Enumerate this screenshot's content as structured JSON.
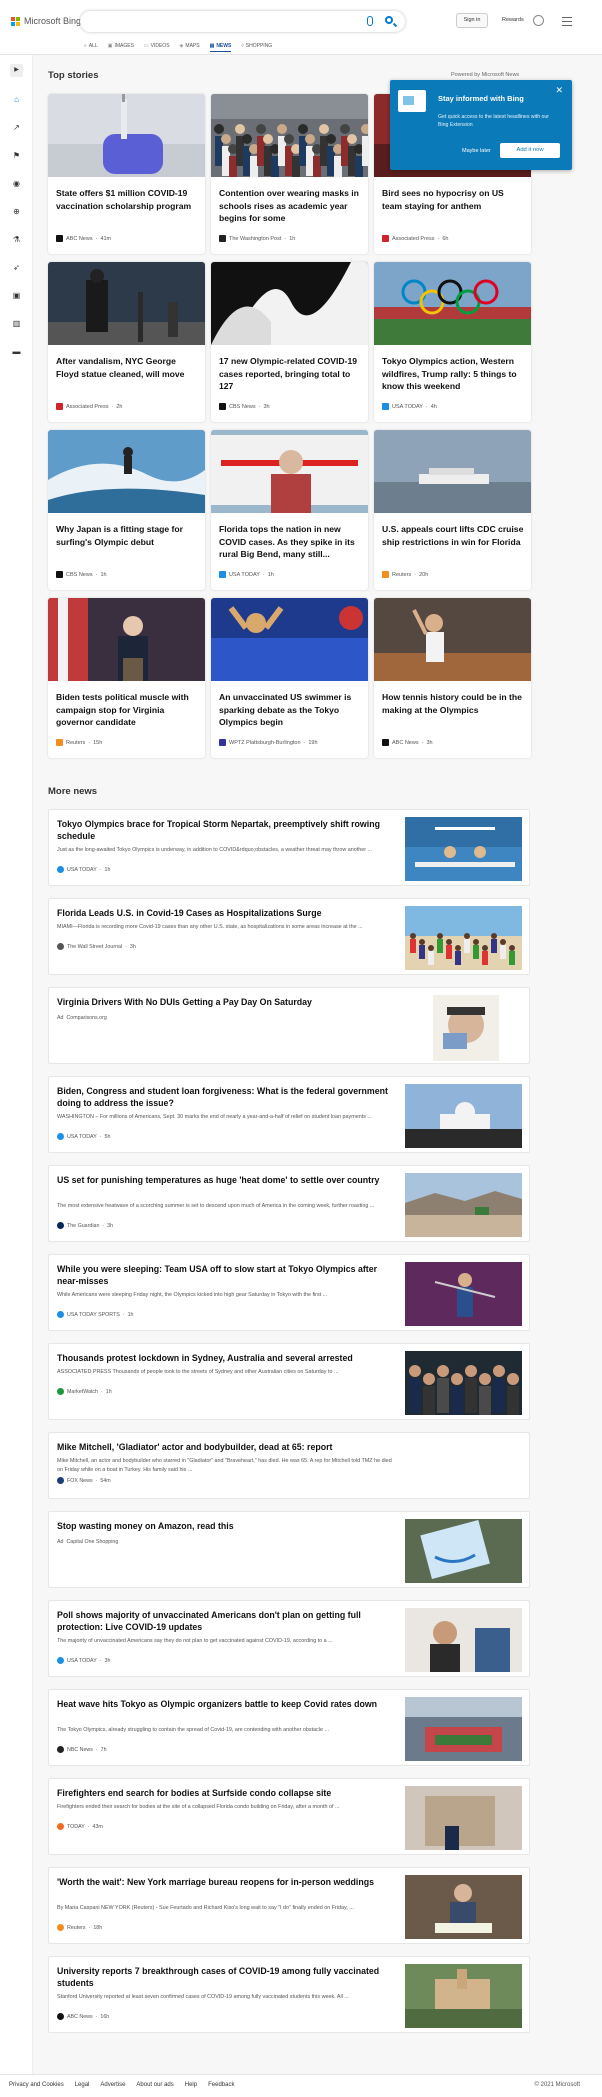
{
  "header": {
    "brand": "Microsoft Bing",
    "signin": "Sign in",
    "rewards": "Rewards",
    "tabs": [
      "ALL",
      "IMAGES",
      "VIDEOS",
      "MAPS",
      "NEWS",
      "SHOPPING"
    ],
    "active_tab": "NEWS"
  },
  "top_stories": {
    "title": "Top stories",
    "powered": "Powered by Microsoft News",
    "cards": [
      {
        "title": "State offers $1 million COVID-19 vaccination scholarship program",
        "source": "ABC News",
        "time": "41m",
        "logo_color": "#111111",
        "image": "vaccine"
      },
      {
        "title": "Contention over wearing masks in schools rises as academic year begins for some",
        "source": "The Washington Post",
        "time": "1h",
        "logo_color": "#222222",
        "image": "crowd"
      },
      {
        "title": "Bird sees no hypocrisy on US team staying for anthem",
        "source": "Associated Press",
        "time": "6h",
        "logo_color": "#d2232a",
        "image": "basketball"
      },
      {
        "title": "After vandalism, NYC George Floyd statue cleaned, will move",
        "source": "Associated Press",
        "time": "2h",
        "logo_color": "#d2232a",
        "image": "statue"
      },
      {
        "title": "17 new Olympic-related COVID-19 cases reported, bringing total to 127",
        "source": "CBS News",
        "time": "3h",
        "logo_color": "#111111",
        "image": "ceremony"
      },
      {
        "title": "Tokyo Olympics action, Western wildfires, Trump rally: 5 things to know this weekend",
        "source": "USA TODAY",
        "time": "4h",
        "logo_color": "#1a8fe3",
        "image": "rings"
      },
      {
        "title": "Why Japan is a fitting stage for surfing's Olympic debut",
        "source": "CBS News",
        "time": "1h",
        "logo_color": "#111111",
        "image": "surf"
      },
      {
        "title": "Florida tops the nation in new COVID cases. As they spike in its rural Big Bend, many still...",
        "source": "USA TODAY",
        "time": "1h",
        "logo_color": "#1a8fe3",
        "image": "ambulance"
      },
      {
        "title": "U.S. appeals court lifts CDC cruise ship restrictions in win for Florida",
        "source": "Reuters",
        "time": "20h",
        "logo_color": "#f48c1e",
        "image": "ship"
      },
      {
        "title": "Biden tests political muscle with campaign stop for Virginia governor candidate",
        "source": "Reuters",
        "time": "15h",
        "logo_color": "#f48c1e",
        "image": "biden"
      },
      {
        "title": "An unvaccinated US swimmer is sparking debate as the Tokyo Olympics begin",
        "source": "WPTZ Plattsburgh-Burlington",
        "time": "19h",
        "logo_color": "#333399",
        "image": "swimmer"
      },
      {
        "title": "How tennis history could be in the making at the Olympics",
        "source": "ABC News",
        "time": "3h",
        "logo_color": "#111111",
        "image": "tennis"
      }
    ]
  },
  "popup": {
    "title": "Stay informed with Bing",
    "body": "Get quick access to the latest headlines with our Bing Extension",
    "later": "Maybe later",
    "add": "Add it now"
  },
  "more_news": {
    "title": "More news",
    "items": [
      {
        "title": "Tokyo Olympics brace for Tropical Storm Nepartak, preemptively shift rowing schedule",
        "desc": "Just as the long-awaited Tokyo Olympics is underway, in addition to COVID&rdquo;obstacles, a weather threat may throw another ...",
        "source": "USA TODAY",
        "time": "1h",
        "logo_color": "#1a8fe3",
        "image": "rowing"
      },
      {
        "title": "Florida Leads U.S. in Covid-19 Cases as Hospitalizations Surge",
        "desc": "MIAMI—Florida is recording more Covid-19 cases than any other U.S. state, as hospitalizations in some areas increase at the ...",
        "source": "The Wall Street Journal",
        "time": "3h",
        "logo_color": "#555555",
        "image": "beach"
      },
      {
        "title": "Virginia Drivers With No DUIs Getting a Pay Day On Saturday",
        "desc": "",
        "source": "Comparisons.org",
        "time": "",
        "ad": "Ad",
        "logo_color": "",
        "image": "oldman"
      },
      {
        "title": "Biden, Congress and student loan forgiveness: What is the federal government doing to address the issue?",
        "desc": "WASHINGTON – For millions of Americans, Sept. 30 marks the end of nearly a year-and-a-half of relief on student loan payments ...",
        "source": "USA TODAY",
        "time": "5h",
        "logo_color": "#1a8fe3",
        "image": "capitol"
      },
      {
        "title": "US set for punishing temperatures as huge 'heat dome' to settle over country",
        "desc": "The most extensive heatwave of a scorching summer is set to descend upon much of America in the coming week, further roasting ...",
        "source": "The Guardian",
        "time": "3h",
        "logo_color": "#05285a",
        "image": "desert"
      },
      {
        "title": "While you were sleeping: Team USA off to slow start at Tokyo Olympics after near-misses",
        "desc": "While Americans were sleeping Friday night, the Olympics kicked into high gear Saturday in Tokyo with the first ...",
        "source": "USA TODAY SPORTS",
        "time": "1h",
        "logo_color": "#1a8fe3",
        "image": "archer"
      },
      {
        "title": "Thousands protest lockdown in Sydney, Australia and several arrested",
        "desc": "ASSOCIATED PRESS Thousands of people took to the streets of Sydney and other Australian cities on Saturday to ...",
        "source": "MarketWatch",
        "time": "1h",
        "logo_color": "#1a9a3a",
        "image": "protest"
      },
      {
        "title": "Mike Mitchell, 'Gladiator' actor and bodybuilder, dead at 65: report",
        "desc": "Mike Mitchell, an actor and bodybuilder who starred in \"Gladiator\" and \"Braveheart,\" has died. He was 65. A rep for Mitchell told TMZ he died on Friday while on a boat in Turkey. His family said his ...",
        "source": "FOX News",
        "time": "54m",
        "logo_color": "#1c3d7a",
        "image": ""
      },
      {
        "title": "Stop wasting money on Amazon, read this",
        "desc": "",
        "source": "Capital One Shopping",
        "time": "",
        "ad": "Ad",
        "logo_color": "",
        "image": "amazon"
      },
      {
        "title": "Poll shows majority of unvaccinated Americans don't plan on getting full protection: Live COVID-19 updates",
        "desc": "The majority of unvaccinated Americans say they do not plan to get vaccinated against COVID-19, according to a ...",
        "source": "USA TODAY",
        "time": "3h",
        "logo_color": "#1a8fe3",
        "image": "shot"
      },
      {
        "title": "Heat wave hits Tokyo as Olympic organizers battle to keep Covid rates down",
        "desc": "The Tokyo Olympics, already struggling to contain the spread of Covid-19, are contending with another obstacle ...",
        "source": "NBC News",
        "time": "7h",
        "logo_color": "#222222",
        "image": "stadium"
      },
      {
        "title": "Firefighters end search for bodies at Surfside condo collapse site",
        "desc": "Firefighters ended their search for bodies at the site of a collapsed Florida condo building on Friday, after a month of ...",
        "source": "TODAY",
        "time": "43m",
        "logo_color": "#f26b21",
        "image": "condo"
      },
      {
        "title": "'Worth the wait': New York marriage bureau reopens for in-person weddings",
        "desc": "By Maria Caspani NEW YORK (Reuters) - Sue Feurtado and Richard Kiso's long wait to say \"I do\" finally ended on Friday, ...",
        "source": "Reuters",
        "time": "18h",
        "logo_color": "#f48c1e",
        "image": "wedding"
      },
      {
        "title": "University reports 7 breakthrough cases of COVID-19 among fully vaccinated students",
        "desc": "Stanford University reported at least seven confirmed cases of COVID-19 among fully vaccinated students this week. All ...",
        "source": "ABC News",
        "time": "16h",
        "logo_color": "#111111",
        "image": "campus"
      }
    ]
  },
  "footer": {
    "links": [
      "Privacy and Cookies",
      "Legal",
      "Advertise",
      "About our ads",
      "Help",
      "Feedback"
    ],
    "copyright": "© 2021 Microsoft"
  },
  "colors": {
    "accent": "#0078d4",
    "popup": "#0b7ab8"
  }
}
